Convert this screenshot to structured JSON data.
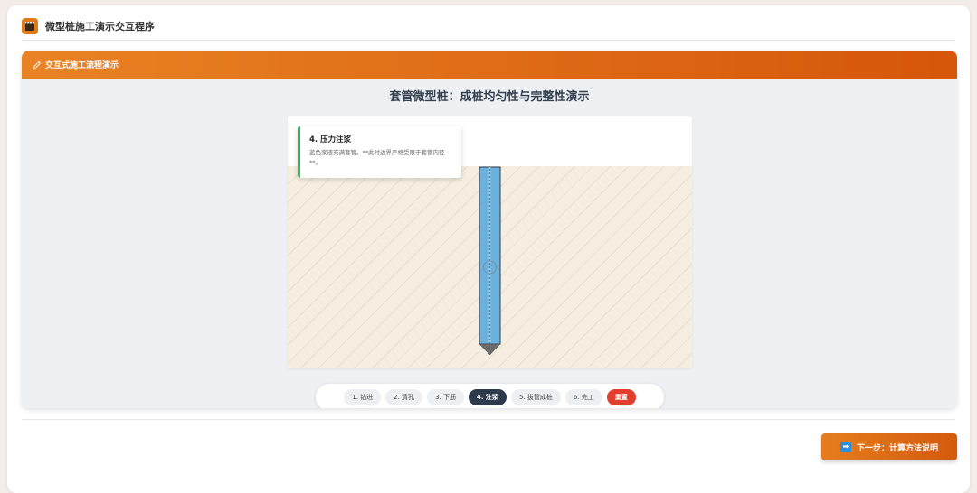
{
  "app": {
    "title": "微型桩施工演示交互程序",
    "icon": "film-clapper-icon"
  },
  "panel": {
    "header_title": "交互式施工流程演示",
    "header_icon": "pencil-icon",
    "demo_title": "套管微型桩：成桩均匀性与完整性演示"
  },
  "info_card": {
    "title": "4. 压力注浆",
    "description": "蓝色浆液充满套管。**此时边界严格受限于套管内径**。"
  },
  "steps": [
    {
      "label": "1. 钻进",
      "active": false
    },
    {
      "label": "2. 清孔",
      "active": false
    },
    {
      "label": "3. 下筋",
      "active": false
    },
    {
      "label": "4. 注浆",
      "active": true
    },
    {
      "label": "5. 拔管成桩",
      "active": false
    },
    {
      "label": "6. 完工",
      "active": false
    }
  ],
  "reset_label": "重置",
  "next_button": {
    "label": "下一步：计算方法说明",
    "icon": "arrow-right-icon"
  },
  "colors": {
    "accent": "#e07a18",
    "grout": "#6cb0dc",
    "active_step": "#2d3a4b",
    "reset": "#e23d2d",
    "success_bar": "#2eb85c",
    "soil": "#f6efe1"
  }
}
